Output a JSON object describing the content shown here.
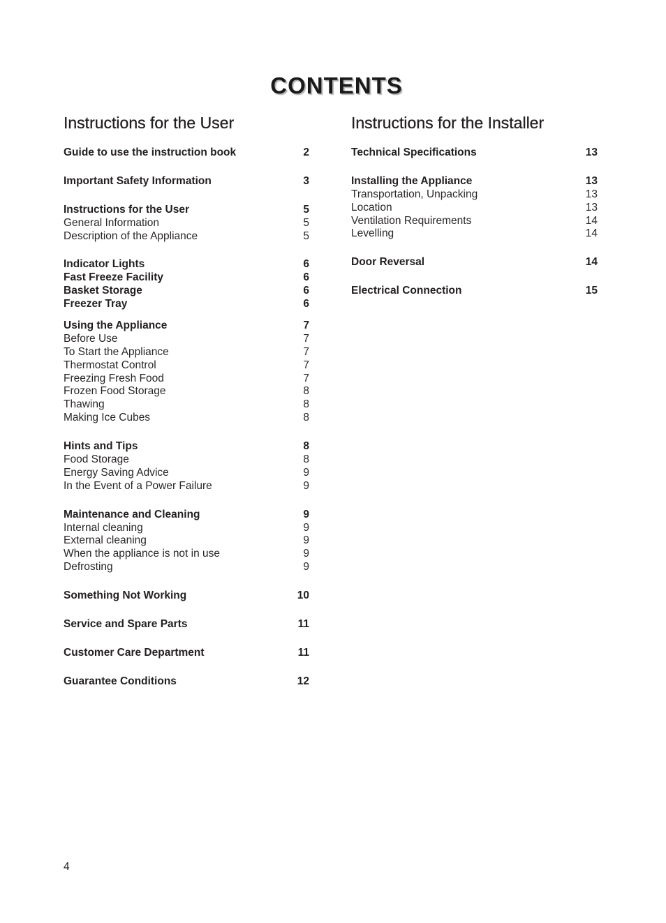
{
  "title": "CONTENTS",
  "columns": [
    {
      "heading": "Instructions for the User",
      "groups": [
        {
          "entries": [
            {
              "label": "Guide to use the instruction book",
              "page": "2",
              "bold": true
            }
          ]
        },
        {
          "entries": [
            {
              "label": "Important Safety Information",
              "page": "3",
              "bold": true
            }
          ]
        },
        {
          "entries": [
            {
              "label": "Instructions for the User",
              "page": "5",
              "bold": true
            },
            {
              "label": "General Information",
              "page": "5",
              "bold": false
            },
            {
              "label": "Description of the Appliance",
              "page": "5",
              "bold": false
            }
          ]
        },
        {
          "tight": true,
          "entries": [
            {
              "label": "Indicator Lights",
              "page": "6",
              "bold": true
            },
            {
              "label": "Fast Freeze Facility",
              "page": "6",
              "bold": true
            },
            {
              "label": "Basket Storage",
              "page": "6",
              "bold": true
            },
            {
              "label": "Freezer Tray",
              "page": "6",
              "bold": true
            }
          ]
        },
        {
          "entries": [
            {
              "label": "Using the Appliance",
              "page": "7",
              "bold": true
            },
            {
              "label": "Before Use",
              "page": "7",
              "bold": false
            },
            {
              "label": "To Start the Appliance",
              "page": "7",
              "bold": false
            },
            {
              "label": "Thermostat Control",
              "page": "7",
              "bold": false
            },
            {
              "label": "Freezing Fresh Food",
              "page": "7",
              "bold": false
            },
            {
              "label": "Frozen Food Storage",
              "page": "8",
              "bold": false
            },
            {
              "label": "Thawing",
              "page": "8",
              "bold": false
            },
            {
              "label": "Making Ice Cubes",
              "page": "8",
              "bold": false
            }
          ]
        },
        {
          "entries": [
            {
              "label": "Hints and Tips",
              "page": "8",
              "bold": true
            },
            {
              "label": "Food Storage",
              "page": "8",
              "bold": false
            },
            {
              "label": "Energy Saving Advice",
              "page": "9",
              "bold": false
            },
            {
              "label": "In the Event of a Power Failure",
              "page": "9",
              "bold": false
            }
          ]
        },
        {
          "entries": [
            {
              "label": "Maintenance and Cleaning",
              "page": "9",
              "bold": true
            },
            {
              "label": "Internal cleaning",
              "page": "9",
              "bold": false
            },
            {
              "label": "External cleaning",
              "page": "9",
              "bold": false
            },
            {
              "label": "When the appliance is not in use",
              "page": "9",
              "bold": false
            },
            {
              "label": "Defrosting",
              "page": "9",
              "bold": false
            }
          ]
        },
        {
          "entries": [
            {
              "label": "Something Not Working",
              "page": "10",
              "bold": true
            }
          ]
        },
        {
          "entries": [
            {
              "label": "Service and Spare Parts",
              "page": "11",
              "bold": true
            }
          ]
        },
        {
          "entries": [
            {
              "label": "Customer Care Department",
              "page": "11",
              "bold": true
            }
          ]
        },
        {
          "entries": [
            {
              "label": "Guarantee Conditions",
              "page": "12",
              "bold": true
            }
          ]
        }
      ]
    },
    {
      "heading": "Instructions for the Installer",
      "groups": [
        {
          "entries": [
            {
              "label": "Technical Specifications",
              "page": "13",
              "bold": true
            }
          ]
        },
        {
          "entries": [
            {
              "label": "Installing the Appliance",
              "page": "13",
              "bold": true
            },
            {
              "label": "Transportation, Unpacking",
              "page": "13",
              "bold": false
            },
            {
              "label": "Location",
              "page": "13",
              "bold": false
            },
            {
              "label": "Ventilation Requirements",
              "page": "14",
              "bold": false
            },
            {
              "label": "Levelling",
              "page": "14",
              "bold": false
            }
          ]
        },
        {
          "entries": [
            {
              "label": "Door Reversal",
              "page": "14",
              "bold": true
            }
          ]
        },
        {
          "entries": [
            {
              "label": "Electrical Connection",
              "page": "15",
              "bold": true
            }
          ]
        }
      ]
    }
  ],
  "page_number": "4"
}
